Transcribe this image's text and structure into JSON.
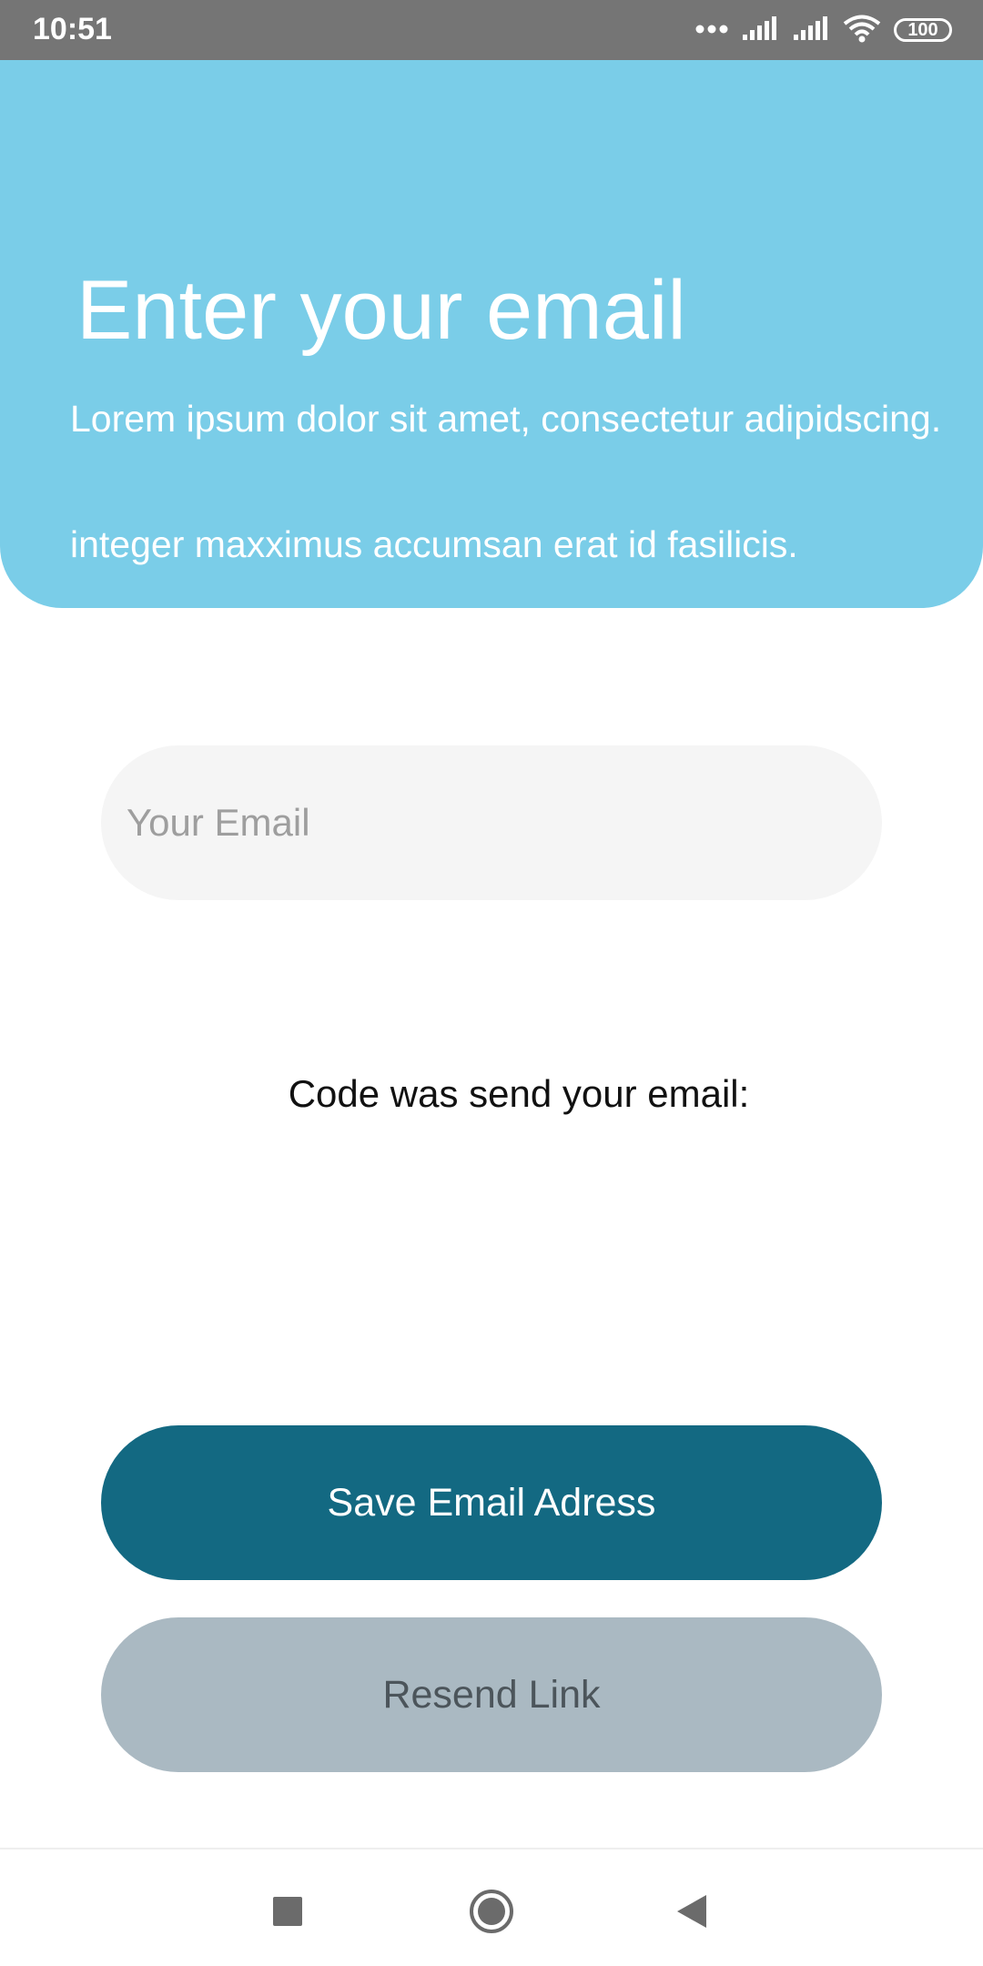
{
  "status_bar": {
    "time": "10:51",
    "battery": "100",
    "icons": [
      "dots-icon",
      "signal-icon",
      "signal-icon",
      "wifi-icon",
      "battery-icon"
    ]
  },
  "header": {
    "title": "Enter your email",
    "description": "Lorem ipsum dolor sit amet, consectetur adipidscing.",
    "description2": "integer maxximus accumsan erat id fasilicis.",
    "background": "#7acde8"
  },
  "form": {
    "email_placeholder": "Your Email",
    "email_value": "",
    "code_message": "Code was send your email:"
  },
  "buttons": {
    "save_label": "Save Email Adress",
    "save_color": "#136982",
    "resend_label": "Resend Link",
    "resend_color": "#aab9c2"
  },
  "nav": {
    "recent": "square-icon",
    "home": "circle-icon",
    "back": "triangle-back-icon"
  }
}
